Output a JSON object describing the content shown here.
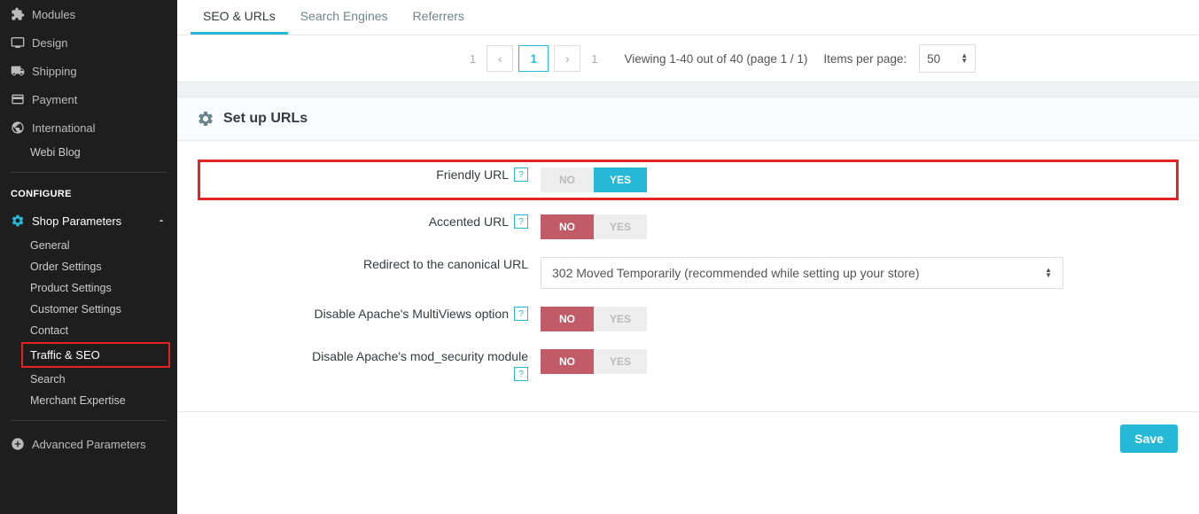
{
  "sidebar": {
    "items": [
      {
        "label": "Modules"
      },
      {
        "label": "Design"
      },
      {
        "label": "Shipping"
      },
      {
        "label": "Payment"
      },
      {
        "label": "International"
      }
    ],
    "blog_label": "Webi Blog",
    "configure_heading": "CONFIGURE",
    "shop_params_label": "Shop Parameters",
    "sub": {
      "general": "General",
      "order_settings": "Order Settings",
      "product_settings": "Product Settings",
      "customer_settings": "Customer Settings",
      "contact": "Contact",
      "traffic_seo": "Traffic & SEO",
      "search": "Search",
      "merchant_expertise": "Merchant Expertise"
    },
    "advanced_label": "Advanced Parameters"
  },
  "tabs": {
    "seo_urls": "SEO & URLs",
    "search_engines": "Search Engines",
    "referrers": "Referrers"
  },
  "pager": {
    "left_total": "1",
    "current": "1",
    "right_total": "1",
    "viewing": "Viewing 1-40 out of 40 (page 1 / 1)",
    "ipp_label": "Items per page:",
    "ipp_value": "50"
  },
  "panel_title": "Set up URLs",
  "toggle_no": "NO",
  "toggle_yes": "YES",
  "fields": {
    "friendly_url": "Friendly URL",
    "accented_url": "Accented URL",
    "redirect_label": "Redirect to the canonical URL",
    "redirect_value": "302 Moved Temporarily (recommended while setting up your store)",
    "multiviews": "Disable Apache's MultiViews option",
    "mod_security": "Disable Apache's mod_security module"
  },
  "save_label": "Save",
  "help_glyph": "?"
}
